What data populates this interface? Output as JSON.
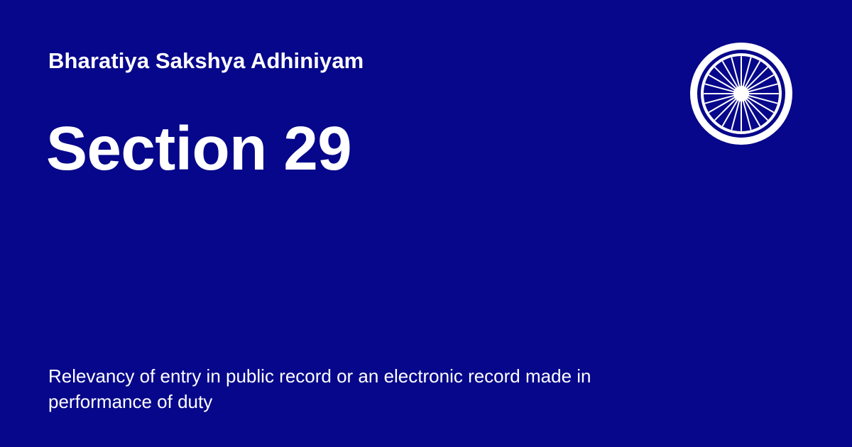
{
  "page": {
    "act_name": "Bharatiya Sakshya Adhiniyam",
    "section_heading": "Section 29",
    "section_description": "Relevancy of entry in public record or an electronic record made in performance of duty"
  },
  "emblem": {
    "icon": "ashoka-chakra-icon",
    "spokes": 24,
    "color": "#ffffff"
  },
  "colors": {
    "background": "#07078b",
    "text": "#ffffff"
  }
}
